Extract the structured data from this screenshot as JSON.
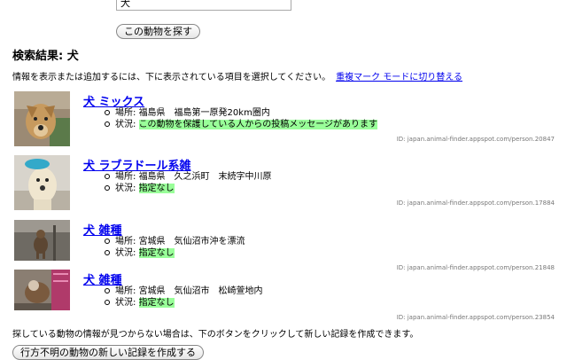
{
  "search": {
    "value": "犬",
    "button_label": "この動物を探す"
  },
  "results": {
    "heading": "検索結果: 犬",
    "instructions": "情報を表示または追加するには、下に表示されている項目を選択してください。",
    "duplicate_link": "重複マーク モードに切り替える",
    "items": [
      {
        "title": "犬 ミックス",
        "location_label": "場所: ",
        "location": "福島県　福島第一原発20km圏内",
        "status_label": "状況: ",
        "status": "この動物を保護している人からの投稿メッセージがあります",
        "id": "ID: japan.animal-finder.appspot.com/person.20847"
      },
      {
        "title": "犬 ラブラドール系雑",
        "location_label": "場所: ",
        "location": "福島県　久之浜町　末続字中川原",
        "status_label": "状況: ",
        "status": "指定なし",
        "id": "ID: japan.animal-finder.appspot.com/person.17884"
      },
      {
        "title": "犬 雑種",
        "location_label": "場所: ",
        "location": "宮城県　気仙沼市沖を漂流",
        "status_label": "状況: ",
        "status": "指定なし",
        "id": "ID: japan.animal-finder.appspot.com/person.21848"
      },
      {
        "title": "犬 雑種",
        "location_label": "場所: ",
        "location": "宮城県　気仙沼市　松崎萱地内",
        "status_label": "状況: ",
        "status": "指定なし",
        "id": "ID: japan.animal-finder.appspot.com/person.23854"
      }
    ]
  },
  "footer": {
    "text": "探している動物の情報が見つからない場合は、下のボタンをクリックして新しい記録を作成できます。",
    "create_button": "行方不明の動物の新しい記録を作成する"
  },
  "colors": {
    "link": "#0000ee",
    "status_highlight": "#99ff99"
  }
}
